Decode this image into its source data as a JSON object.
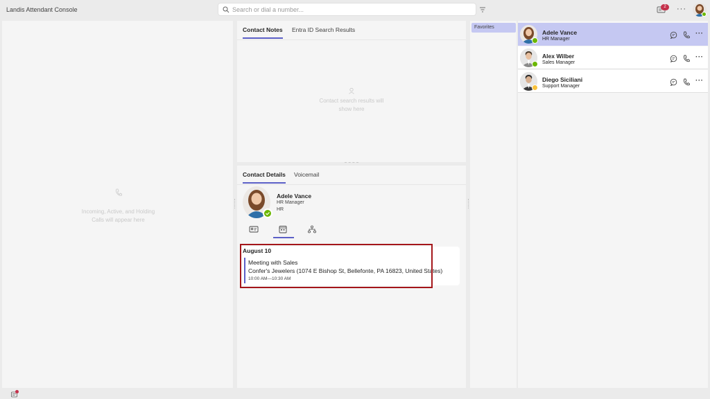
{
  "app": {
    "title": "Landis Attendant Console"
  },
  "search": {
    "placeholder": "Search or dial a number..."
  },
  "header": {
    "notification_count": "2"
  },
  "calls_panel": {
    "empty_message": "Incoming, Active, and Holding Calls will appear here"
  },
  "notes_panel": {
    "tabs": [
      {
        "label": "Contact Notes",
        "active": true
      },
      {
        "label": "Entra ID Search Results",
        "active": false
      }
    ],
    "empty_message": "Contact search results will show here"
  },
  "details_panel": {
    "tabs": [
      {
        "label": "Contact Details",
        "active": true
      },
      {
        "label": "Voicemail",
        "active": false
      }
    ],
    "contact": {
      "name": "Adele Vance",
      "title": "HR Manager",
      "department": "HR",
      "status_color": "#6bb700"
    },
    "detail_tabs": [
      "contact-card-icon",
      "calendar-icon",
      "org-chart-icon"
    ],
    "event": {
      "date": "August 10",
      "title": "Meeting with Sales",
      "location": "Confer's Jewelers (1074 E Bishop St, Bellefonte, PA 16823, United States)",
      "time": "10:00 AM—10:30 AM"
    }
  },
  "groups_panel": {
    "items": [
      {
        "label": "Favorites",
        "selected": true
      }
    ]
  },
  "contacts": [
    {
      "name": "Adele Vance",
      "title": "HR Manager",
      "status": "available",
      "status_color": "#6bb700",
      "selected": true
    },
    {
      "name": "Alex Wilber",
      "title": "Sales Manager",
      "status": "available",
      "status_color": "#6bb700",
      "selected": false
    },
    {
      "name": "Diego Siciliani",
      "title": "Support Manager",
      "status": "away",
      "status_color": "#f8c13b",
      "selected": false
    }
  ],
  "colors": {
    "accent": "#5b5fc7",
    "highlight": "#a4161a",
    "selected_bg": "#c5c8f2"
  }
}
